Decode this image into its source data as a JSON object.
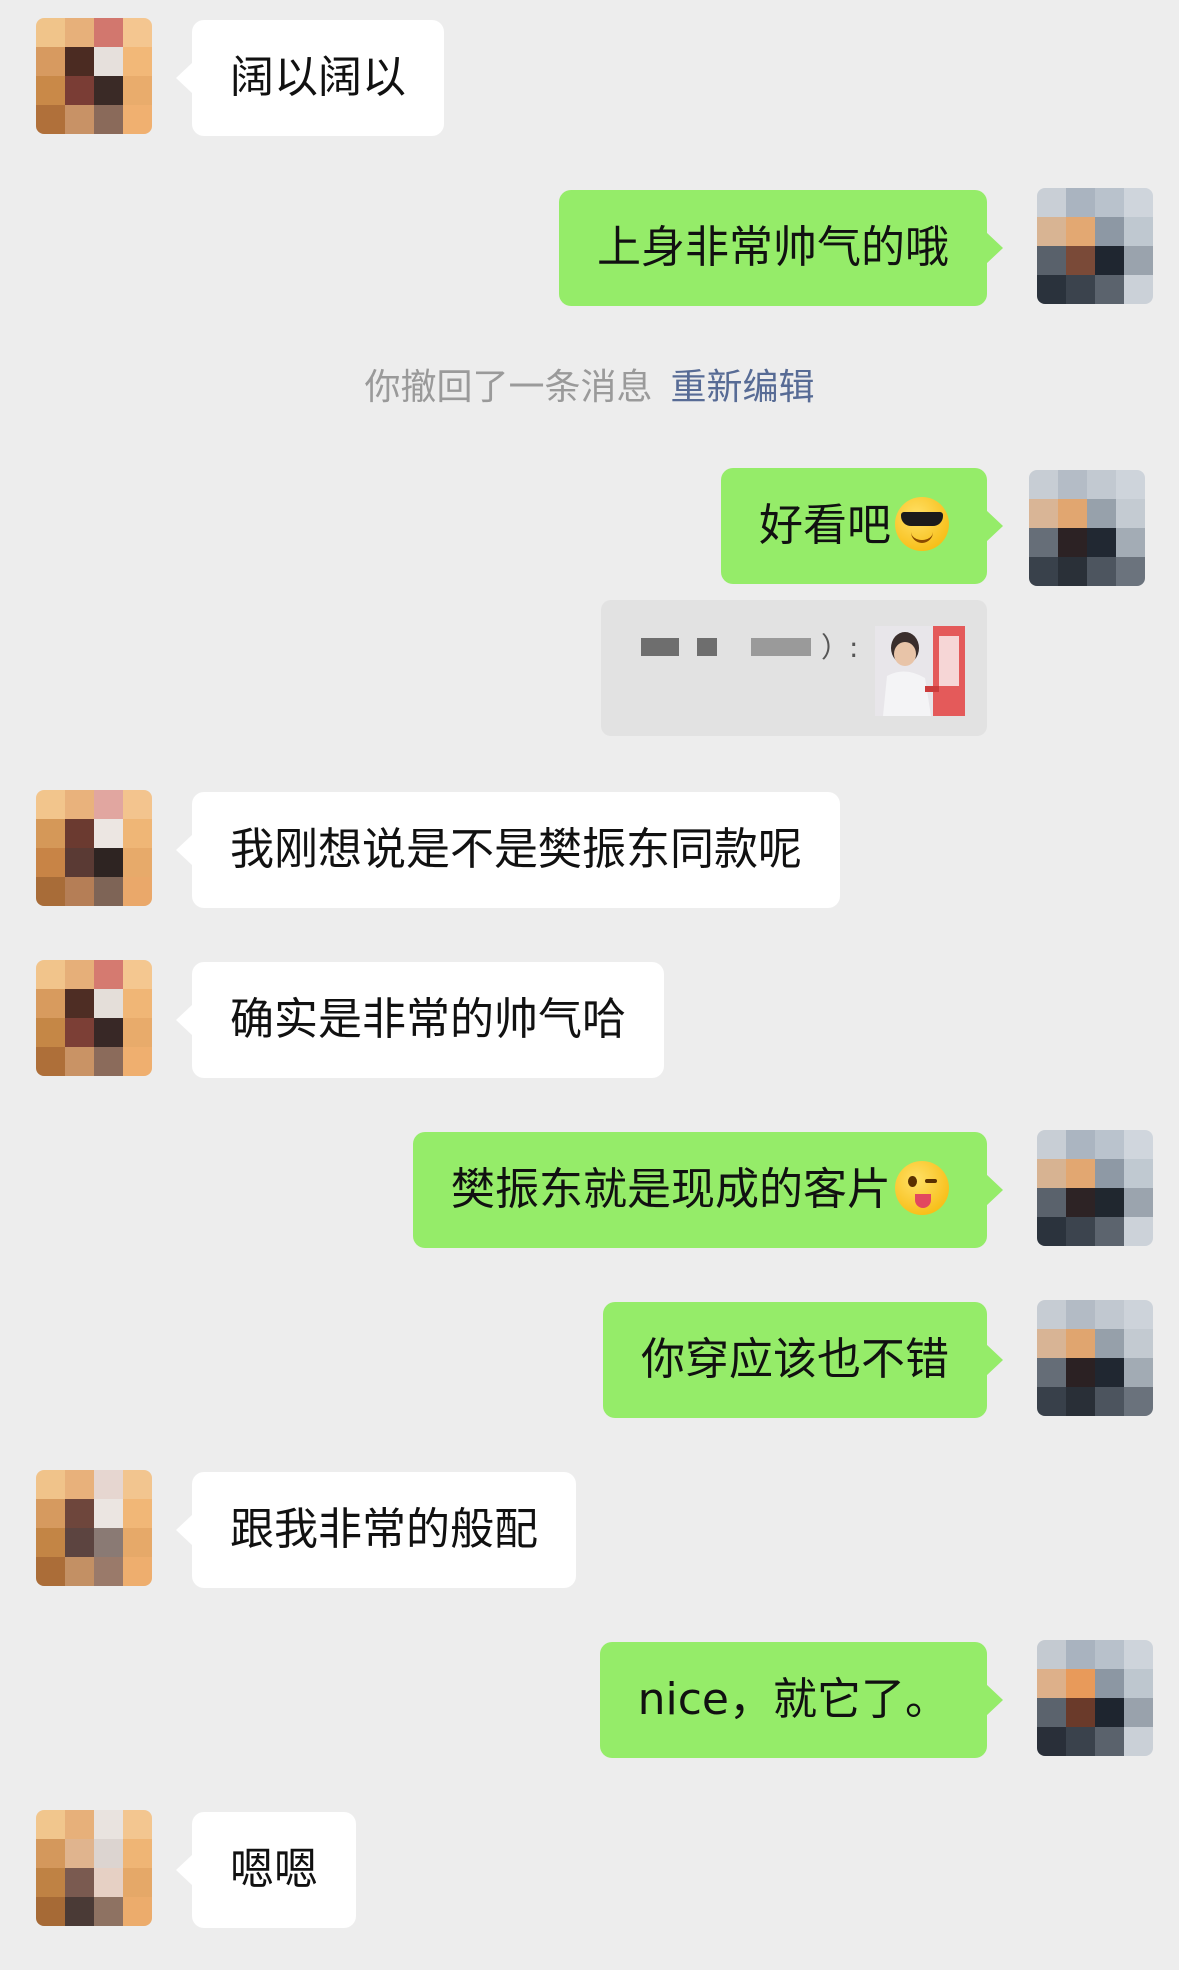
{
  "messages": [
    {
      "id": "m1",
      "side": "in",
      "text": "阔以阔以"
    },
    {
      "id": "m2",
      "side": "out",
      "text": "上身非常帅气的哦"
    },
    {
      "id": "m4",
      "side": "out",
      "text": "好看吧",
      "emoji": "cool-sunglasses-emoji"
    },
    {
      "id": "m5",
      "side": "in",
      "text": "我刚想说是不是樊振东同款呢"
    },
    {
      "id": "m6",
      "side": "in",
      "text": "确实是非常的帅气哈"
    },
    {
      "id": "m7",
      "side": "out",
      "text": "樊振东就是现成的客片",
      "emoji": "winking-tongue-emoji"
    },
    {
      "id": "m8",
      "side": "out",
      "text": "你穿应该也不错"
    },
    {
      "id": "m9",
      "side": "in",
      "text": "跟我非常的般配"
    },
    {
      "id": "m10",
      "side": "out",
      "text": "nice，就它了。"
    },
    {
      "id": "m11",
      "side": "in",
      "text": "嗯嗯"
    }
  ],
  "recall_notice": {
    "text": "你撤回了一条消息",
    "action": "重新编辑"
  },
  "quote": {
    "sender_masked": true,
    "suffix": "）:",
    "thumbnail": "quoted-photo-thumbnail"
  },
  "colors": {
    "background": "#ededed",
    "incoming_bubble": "#ffffff",
    "outgoing_bubble": "#95ec69",
    "link": "#576b95",
    "system_text": "#9a9a9a"
  }
}
